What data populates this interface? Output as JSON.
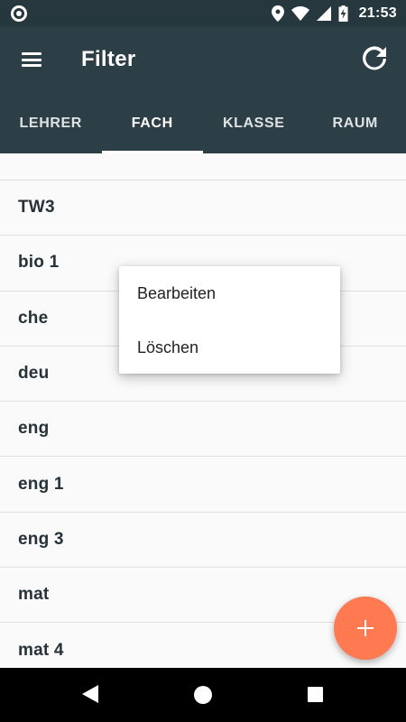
{
  "status_bar": {
    "time": "21:53"
  },
  "app_bar": {
    "title": "Filter"
  },
  "tabs": [
    {
      "label": "LEHRER"
    },
    {
      "label": "FACH"
    },
    {
      "label": "KLASSE"
    },
    {
      "label": "RAUM"
    }
  ],
  "list": {
    "items": [
      "TW3",
      "bio 1",
      "che",
      "deu",
      "eng",
      "eng 1",
      "eng 3",
      "mat",
      "mat  4"
    ]
  },
  "context_menu": {
    "edit_label": "Bearbeiten",
    "delete_label": "Löschen"
  },
  "colors": {
    "app_bar": "#2c3f47",
    "status_bar": "#27373e",
    "fab": "#ff7a50"
  }
}
